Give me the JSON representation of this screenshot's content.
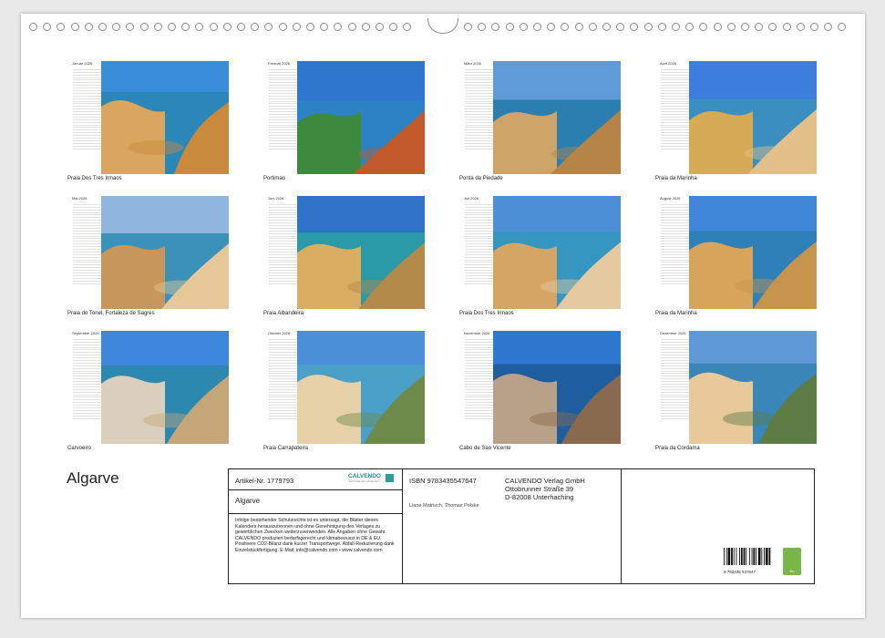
{
  "title": "Algarve",
  "months": [
    {
      "name": "Januar 2026",
      "caption": "Praia Dos Tres Irmaos"
    },
    {
      "name": "Februar 2026",
      "caption": "Portimao"
    },
    {
      "name": "März 2026",
      "caption": "Ponta da Piedade"
    },
    {
      "name": "April 2026",
      "caption": "Praia da Marinha"
    },
    {
      "name": "Mai 2026",
      "caption": "Praia do Tonel, Fortaleza de Sagres"
    },
    {
      "name": "Juni 2026",
      "caption": "Praia Albandeira"
    },
    {
      "name": "Juli 2026",
      "caption": "Praia Dos Tres Irmaos"
    },
    {
      "name": "August 2026",
      "caption": "Praia da Marinha"
    },
    {
      "name": "September 2026",
      "caption": "Carvoeiro"
    },
    {
      "name": "Oktober 2026",
      "caption": "Praia Carrapateira"
    },
    {
      "name": "November 2026",
      "caption": "Cabo de Sao Vicente"
    },
    {
      "name": "Dezember 2026",
      "caption": "Praia da Cordama"
    }
  ],
  "info": {
    "article": "Artikel-Nr. 1779793",
    "logo": "CALVENDO",
    "logo_tagline": "Jetzt Kalender entdecken",
    "subtitle": "Algarve",
    "legal": "Infolge bestehender Schutzrechte ist es untersagt, die Blätter dieses Kalenders herauszutrennen und ohne Genehmigung des Verlages zu gewerblichen Zwecken weiterzuverwenden. Alle Angaben ohne Gewähr. CALVENDO produziert bedarfsgerecht und klimabewusst in DE & EU. Positivere CO2-Bilanz dank kurzer Transportwege. Abfall-Reduzierung dank Einzelstückfertigung. E-Mail: info@calvendo.com • www.calvendo.com",
    "isbn": "ISBN 9783435547647",
    "publisher1": "CALVENDO Verlag GmbH",
    "publisher2": "Ottobrunner Straße 39",
    "publisher3": "D-82008 Unterhaching",
    "authors": "Liane Matrisch, Thomas Polske",
    "barcode_number": "9 783435 547647",
    "fsc_label": "fsc"
  },
  "colors": {
    "sky": "#3b7fd1",
    "sea": "#1d6aa6",
    "rock": "#d4a35a",
    "sand": "#e8c89a"
  }
}
